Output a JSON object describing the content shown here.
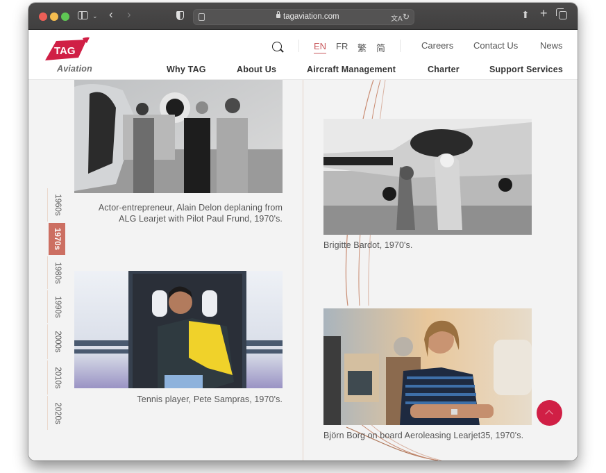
{
  "browser": {
    "url": "tagaviation.com",
    "icons": [
      "sidebar-toggle-icon",
      "chevron-down-icon",
      "back-arrow-icon",
      "forward-arrow-icon",
      "privacy-shield-icon",
      "reader-icon",
      "lock-icon",
      "translate-icon",
      "reload-icon",
      "share-icon",
      "new-tab-icon",
      "tab-overview-icon"
    ]
  },
  "header": {
    "logo_text": "TAG",
    "logo_sub": "Aviation",
    "brand_color": "#d01f45",
    "languages": [
      {
        "label": "EN",
        "active": true
      },
      {
        "label": "FR",
        "active": false
      },
      {
        "label": "繁",
        "active": false
      },
      {
        "label": "简",
        "active": false
      }
    ],
    "utility_links": [
      "Careers",
      "Contact Us",
      "News"
    ],
    "main_nav": [
      "Why TAG",
      "About Us",
      "Aircraft Management",
      "Charter",
      "Support Services"
    ]
  },
  "timeline": {
    "items": [
      "1960s",
      "1970s",
      "1980s",
      "1990s",
      "2000s",
      "2010s",
      "2020s"
    ],
    "active": "1970s",
    "active_color": "#cc6f62"
  },
  "gallery": [
    {
      "caption": "Actor-entrepreneur, Alain Delon deplaning from ALG Learjet with Pilot Paul Frund, 1970's.",
      "alt": "Black-and-white photo of three men beside a Learjet"
    },
    {
      "caption": "Brigitte Bardot, 1970's.",
      "alt": "Black-and-white photo of a woman with a cheetah beside a propeller plane"
    },
    {
      "caption": "Tennis player, Pete Sampras, 1970's.",
      "alt": "Man in yellow and navy jacket stepping out of a jet door"
    },
    {
      "caption": "Björn Borg on board Aeroleasing Learjet35, 1970's.",
      "alt": "Smiling man in striped shirt seated in a jet cabin"
    }
  ],
  "scroll_top": {
    "icon": "chevron-up-icon",
    "color": "#d01f45"
  }
}
